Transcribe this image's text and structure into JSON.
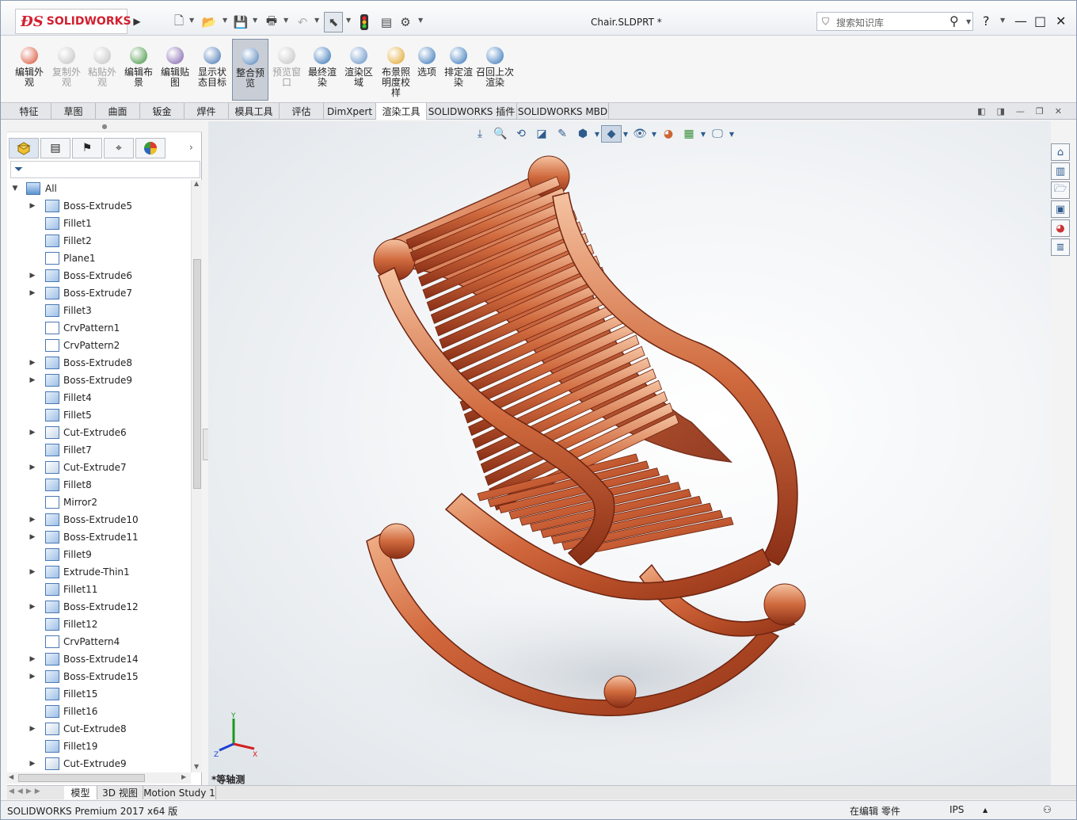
{
  "app": {
    "logo": "SOLIDWORKS",
    "doc_title": "Chair.SLDPRT *",
    "search_placeholder": "搜索知识库",
    "help": "?",
    "minimize": "—",
    "maximize": "□",
    "close": "✕"
  },
  "commands": [
    {
      "label": "编辑外观",
      "color": "#d84a2e",
      "enabled": true
    },
    {
      "label": "复制外观",
      "color": "#c0c0c0",
      "enabled": false
    },
    {
      "label": "粘贴外观",
      "color": "#c0c0c0",
      "enabled": false
    },
    {
      "label": "编辑布景",
      "color": "#3a8f3a",
      "enabled": true
    },
    {
      "label": "编辑贴图",
      "color": "#7a5aa8",
      "enabled": true
    },
    {
      "label": "显示状态目标",
      "color": "#3e6fb0",
      "enabled": true
    },
    {
      "label": "整合预览",
      "color": "#4b7db8",
      "enabled": true,
      "active": true
    },
    {
      "label": "预览窗口",
      "color": "#c0c0c0",
      "enabled": false
    },
    {
      "label": "最终渲染",
      "color": "#2c6fb6",
      "enabled": true
    },
    {
      "label": "渲染区域",
      "color": "#5c8bc4",
      "enabled": true
    },
    {
      "label": "布景照明度校样",
      "color": "#e0a020",
      "enabled": true
    },
    {
      "label": "选项",
      "color": "#2c6fb6",
      "enabled": true
    },
    {
      "label": "排定渲染",
      "color": "#2c6fb6",
      "enabled": true
    },
    {
      "label": "召回上次渲染",
      "color": "#2c6fb6",
      "enabled": true
    }
  ],
  "tabs": [
    {
      "label": "特征"
    },
    {
      "label": "草图"
    },
    {
      "label": "曲面"
    },
    {
      "label": "钣金"
    },
    {
      "label": "焊件"
    },
    {
      "label": "模具工具"
    },
    {
      "label": "评估"
    },
    {
      "label": "DimXpert"
    },
    {
      "label": "渲染工具",
      "selected": true
    },
    {
      "label": "SOLIDWORKS 插件"
    },
    {
      "label": "SOLIDWORKS MBD"
    }
  ],
  "tree": {
    "root": "All",
    "items": [
      {
        "label": "Boss-Extrude5",
        "expand": true,
        "type": "boss"
      },
      {
        "label": "Fillet1",
        "expand": false,
        "type": "fillet"
      },
      {
        "label": "Fillet2",
        "expand": false,
        "type": "fillet"
      },
      {
        "label": "Plane1",
        "expand": false,
        "type": "plane"
      },
      {
        "label": "Boss-Extrude6",
        "expand": true,
        "type": "boss"
      },
      {
        "label": "Boss-Extrude7",
        "expand": true,
        "type": "boss"
      },
      {
        "label": "Fillet3",
        "expand": false,
        "type": "fillet"
      },
      {
        "label": "CrvPattern1",
        "expand": false,
        "type": "pattern"
      },
      {
        "label": "CrvPattern2",
        "expand": false,
        "type": "pattern"
      },
      {
        "label": "Boss-Extrude8",
        "expand": true,
        "type": "boss"
      },
      {
        "label": "Boss-Extrude9",
        "expand": true,
        "type": "boss"
      },
      {
        "label": "Fillet4",
        "expand": false,
        "type": "fillet"
      },
      {
        "label": "Fillet5",
        "expand": false,
        "type": "fillet"
      },
      {
        "label": "Cut-Extrude6",
        "expand": true,
        "type": "cut"
      },
      {
        "label": "Fillet7",
        "expand": false,
        "type": "fillet"
      },
      {
        "label": "Cut-Extrude7",
        "expand": true,
        "type": "cut"
      },
      {
        "label": "Fillet8",
        "expand": false,
        "type": "fillet"
      },
      {
        "label": "Mirror2",
        "expand": false,
        "type": "mirror"
      },
      {
        "label": "Boss-Extrude10",
        "expand": true,
        "type": "boss"
      },
      {
        "label": "Boss-Extrude11",
        "expand": true,
        "type": "boss"
      },
      {
        "label": "Fillet9",
        "expand": false,
        "type": "fillet"
      },
      {
        "label": "Extrude-Thin1",
        "expand": true,
        "type": "boss"
      },
      {
        "label": "Fillet11",
        "expand": false,
        "type": "fillet"
      },
      {
        "label": "Boss-Extrude12",
        "expand": true,
        "type": "boss"
      },
      {
        "label": "Fillet12",
        "expand": false,
        "type": "fillet"
      },
      {
        "label": "CrvPattern4",
        "expand": false,
        "type": "pattern"
      },
      {
        "label": "Boss-Extrude14",
        "expand": true,
        "type": "boss"
      },
      {
        "label": "Boss-Extrude15",
        "expand": true,
        "type": "boss"
      },
      {
        "label": "Fillet15",
        "expand": false,
        "type": "fillet"
      },
      {
        "label": "Fillet16",
        "expand": false,
        "type": "fillet"
      },
      {
        "label": "Cut-Extrude8",
        "expand": true,
        "type": "cut"
      },
      {
        "label": "Fillet19",
        "expand": false,
        "type": "fillet"
      },
      {
        "label": "Cut-Extrude9",
        "expand": true,
        "type": "cut"
      }
    ]
  },
  "viewport": {
    "view_name": "*等轴测",
    "triad": {
      "x": "X",
      "y": "Y",
      "z": "Z"
    }
  },
  "bottom_tabs": [
    {
      "label": "模型",
      "selected": true
    },
    {
      "label": "3D 视图"
    },
    {
      "label": "Motion Study 1"
    }
  ],
  "status": {
    "app_version": "SOLIDWORKS Premium 2017 x64 版",
    "editing": "在编辑 零件",
    "units": "IPS"
  },
  "colors": {
    "wood_light": "#e79a6c",
    "wood_mid": "#c0512c",
    "wood_dark": "#8a2e17",
    "accent_blue": "#2f5c8d",
    "brand_red": "#d2202f"
  }
}
